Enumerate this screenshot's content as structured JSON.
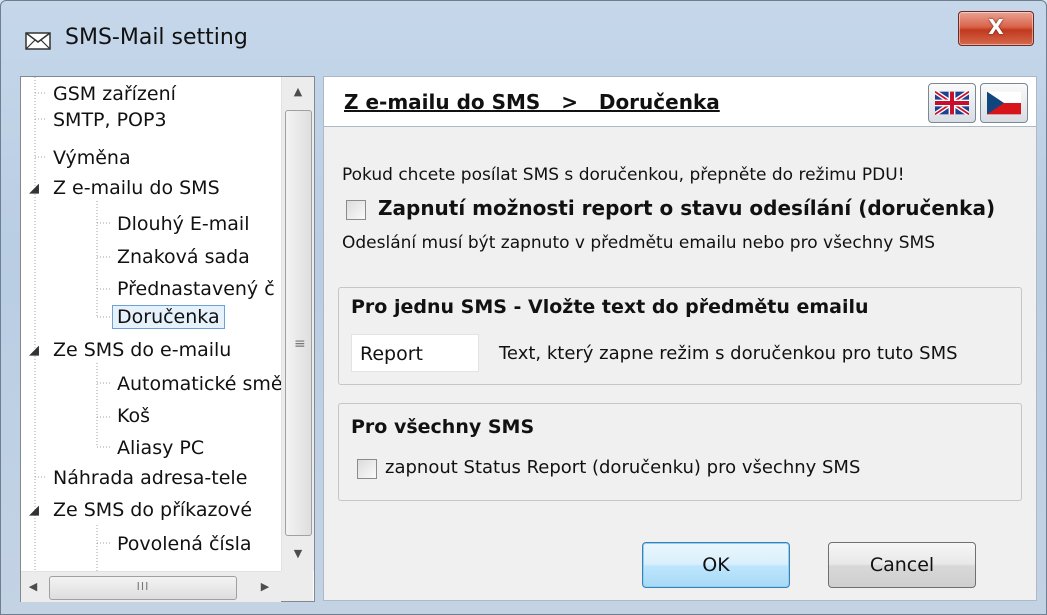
{
  "window": {
    "title": "SMS-Mail setting",
    "close_label": "X"
  },
  "tree": {
    "items": [
      {
        "label": "GSM zařízení",
        "level": 1
      },
      {
        "label": "SMTP, POP3",
        "level": 1
      },
      {
        "label": "Výměna",
        "level": 1
      },
      {
        "label": "Z e-mailu do SMS",
        "level": 1,
        "expanded": true
      },
      {
        "label": "Dlouhý E-mail",
        "level": 2
      },
      {
        "label": "Znaková sada",
        "level": 2
      },
      {
        "label": "Přednastavený č",
        "level": 2
      },
      {
        "label": "Doručenka",
        "level": 2,
        "selected": true
      },
      {
        "label": "Ze SMS do e-mailu",
        "level": 1,
        "expanded": true
      },
      {
        "label": "Automatické smě",
        "level": 2
      },
      {
        "label": "Koš",
        "level": 2
      },
      {
        "label": "Aliasy PC",
        "level": 2
      },
      {
        "label": "Náhrada adresa-tele",
        "level": 1
      },
      {
        "label": "Ze SMS do příkazové",
        "level": 1,
        "expanded": true
      },
      {
        "label": "Povolená čísla",
        "level": 2
      }
    ],
    "scroll_h_grip": "III"
  },
  "header": {
    "breadcrumb": "Z e-mailu do SMS   >   Doručenka"
  },
  "content": {
    "pdu_note": "Pokud chcete posílat SMS s doručenkou, přepněte do režimu PDU!",
    "report_checkbox_label": "Zapnutí možnosti report o stavu odesílání (doručenka)",
    "report_checkbox_checked": false,
    "subject_note": "Odeslání musí být zapnuto v předmětu emailu nebo pro všechny SMS",
    "group_single": {
      "title": "Pro jednu SMS - Vložte text do předmětu emailu",
      "field_value": "Report",
      "field_hint": "Text, který zapne režim s doručenkou pro tuto SMS"
    },
    "group_all": {
      "title": "Pro všechny SMS",
      "checkbox_label": "zapnout Status Report (doručenku) pro všechny SMS",
      "checkbox_checked": false
    }
  },
  "footer": {
    "ok_label": "OK",
    "cancel_label": "Cancel"
  },
  "colors": {
    "titlebar": "#c6d7ea",
    "close": "#c2391f",
    "selection": "#e5f1fb",
    "ok_border": "#3c7fb1"
  }
}
